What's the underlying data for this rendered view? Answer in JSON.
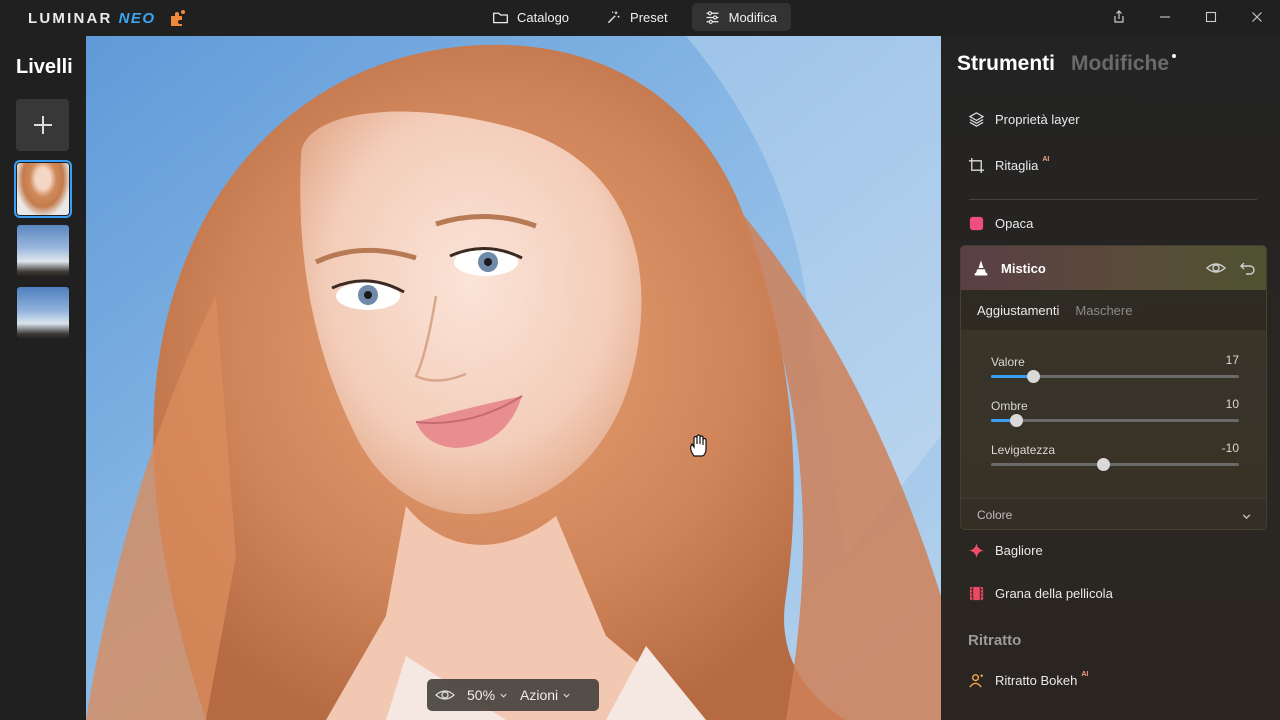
{
  "app": {
    "logo_word": "LUMINAR",
    "logo_neo": "NEO",
    "modes": [
      {
        "label": "Catalogo",
        "icon": "folder-icon"
      },
      {
        "label": "Preset",
        "icon": "magic-wand-icon"
      },
      {
        "label": "Modifica",
        "icon": "sliders-icon",
        "active": true
      }
    ],
    "accent_color": "#3a9ef5"
  },
  "layers": {
    "title": "Livelli",
    "items": [
      "portrait-layer",
      "sky-layer-1",
      "sky-layer-2"
    ],
    "selected_index": 0
  },
  "canvas": {
    "zoom_label": "50%",
    "actions_label": "Azioni"
  },
  "panel": {
    "tabs": [
      {
        "label": "Strumenti",
        "active": true
      },
      {
        "label": "Modifiche",
        "active": false,
        "has_dot": true
      }
    ],
    "tools": {
      "layer_properties": "Proprietà layer",
      "crop": "Ritaglia",
      "ai_badge": "AI",
      "matte": "Opaca",
      "glow": "Bagliore",
      "film_grain": "Grana della pellicola"
    },
    "mystic": {
      "title": "Mistico",
      "subtabs": [
        "Aggiustamenti",
        "Maschere"
      ],
      "sliders": [
        {
          "label": "Valore",
          "value": 17,
          "min": 0,
          "max": 100
        },
        {
          "label": "Ombre",
          "value": 10,
          "min": 0,
          "max": 100
        },
        {
          "label": "Levigatezza",
          "value": -10,
          "min": -100,
          "max": 100
        }
      ],
      "color_section": "Colore"
    },
    "portrait_section": {
      "title": "Ritratto",
      "bokeh": "Ritratto Bokeh"
    }
  }
}
